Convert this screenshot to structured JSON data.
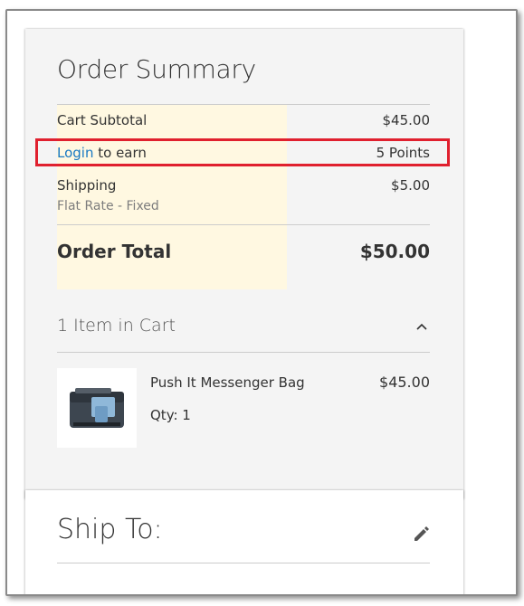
{
  "summary": {
    "title": "Order Summary",
    "cart_subtotal_label": "Cart Subtotal",
    "cart_subtotal_value": "$45.00",
    "login_link": "Login",
    "login_suffix": " to earn",
    "points_value": "5 Points",
    "shipping_label": "Shipping",
    "shipping_method": "Flat Rate - Fixed",
    "shipping_value": "$5.00",
    "order_total_label": "Order Total",
    "order_total_value": "$50.00"
  },
  "cart": {
    "items_header": "1 Item in Cart",
    "items": [
      {
        "name": "Push It Messenger Bag",
        "price": "$45.00",
        "qty": "Qty: 1"
      }
    ]
  },
  "ship_to": {
    "title": "Ship To:"
  },
  "colors": {
    "link": "#1979c3",
    "highlight_border": "#e0202e",
    "highlight_bg": "#fff8e1",
    "panel_bg": "#f4f4f4"
  },
  "icons": {
    "collapse": "chevron-up-icon",
    "edit": "pencil-icon",
    "product": "messenger-bag-thumbnail"
  }
}
